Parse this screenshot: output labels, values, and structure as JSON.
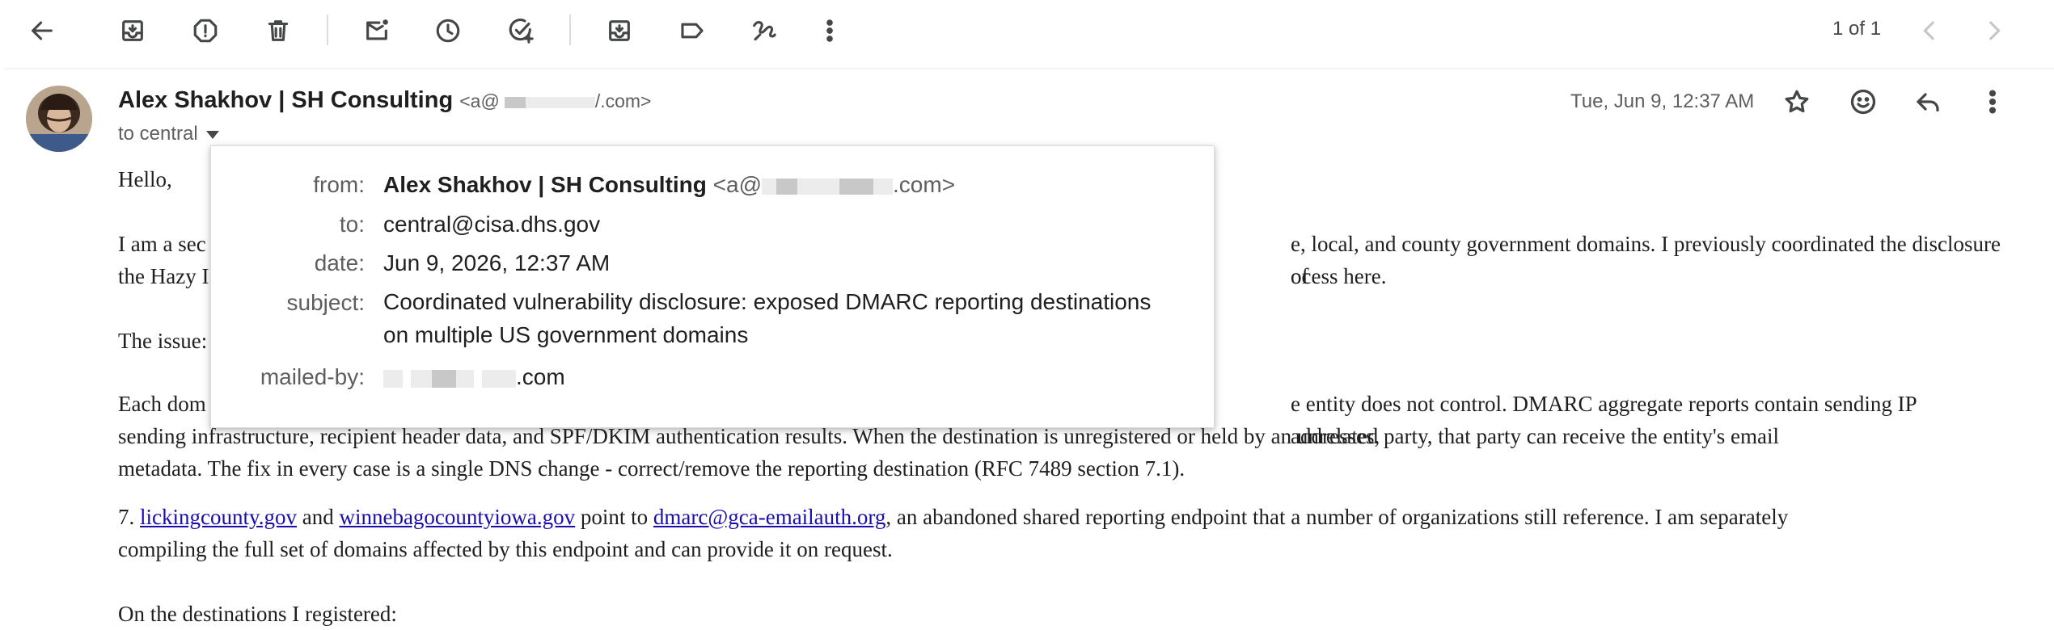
{
  "toolbar": {
    "icons": [
      "back-arrow-icon",
      "archive-icon",
      "report-spam-icon",
      "delete-icon",
      "mark-unread-icon",
      "snooze-icon",
      "add-to-tasks-icon",
      "move-to-icon",
      "label-icon",
      "filter-icon",
      "more-vert-icon"
    ],
    "pager": "1 of 1"
  },
  "message": {
    "sender_name": "Alex Shakhov | SH Consulting",
    "sender_email_prefix": "<a@",
    "sender_email_suffix": "/.com>",
    "to_line": "to central",
    "date": "Tue, Jun 9, 12:37 AM"
  },
  "details_popup": {
    "from_label": "from:",
    "from_name": "Alex Shakhov | SH Consulting",
    "from_email_prefix": "<a@",
    "from_email_suffix": ".com>",
    "to_label": "to:",
    "to_value": "central@cisa.dhs.gov",
    "date_label": "date:",
    "date_value": "Jun 9, 2026, 12:37 AM",
    "subject_label": "subject:",
    "subject_line1": "Coordinated vulnerability disclosure: exposed DMARC reporting destinations",
    "subject_line2": "on multiple US government domains",
    "mailed_by_label": "mailed-by:",
    "mailed_by_suffix": ".com"
  },
  "body": {
    "greeting": "Hello,",
    "p1_a": "I am a sec",
    "p1_b": "e, local, and county government domains. I previously coordinated the disclosure of",
    "p1_c": "the Hazy I",
    "p1_d": "ocess here.",
    "p2": "The issue:",
    "p3_a": "Each dom",
    "p3_b": "e entity does not control. DMARC aggregate reports contain sending IP addresses,",
    "p3_line2": "sending infrastructure, recipient header data, and SPF/DKIM authentication results. When the destination is unregistered or held by an unrelated party, that party can receive the entity's email",
    "p3_line3": "metadata. The fix in every case is a single DNS change - correct/remove the reporting destination (RFC 7489 section 7.1).",
    "p4_num": "7. ",
    "p4_link1": "lickingcounty.gov",
    "p4_and": " and ",
    "p4_link2": "winnebagocountyiowa.gov",
    "p4_point": " point to ",
    "p4_link3": "dmarc@gca-emailauth.org",
    "p4_rest": ", an abandoned shared reporting endpoint that a number of organizations still reference. I am separately",
    "p4_line2": "compiling the full set of domains affected by this endpoint and can provide it on request.",
    "p5": "On the destinations I registered:"
  }
}
